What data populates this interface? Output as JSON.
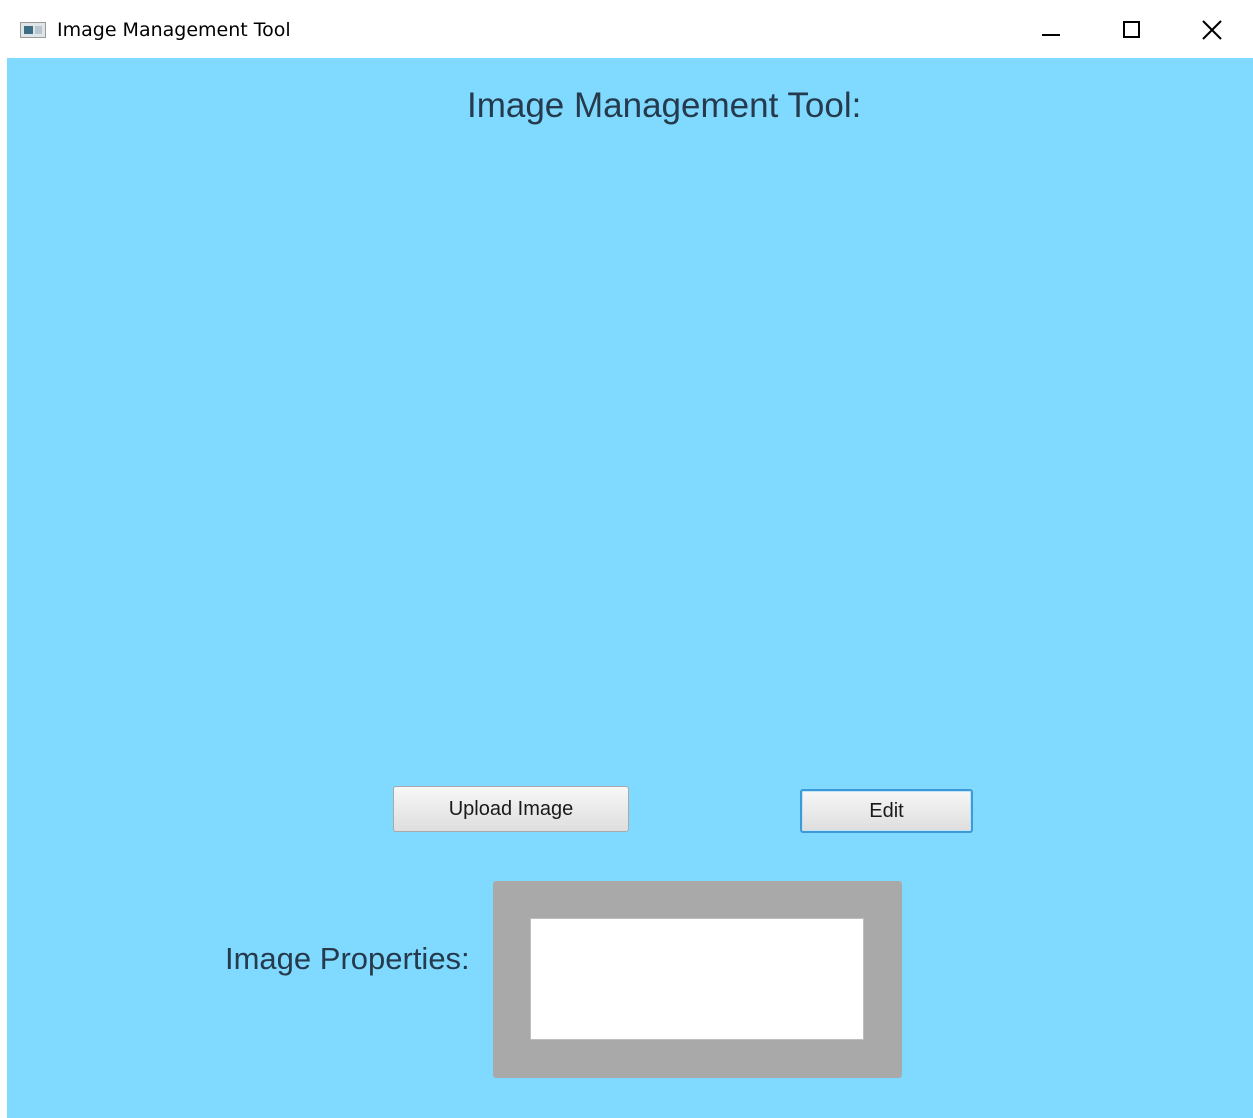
{
  "window": {
    "title": "Image Management Tool"
  },
  "main": {
    "heading": "Image Management Tool:",
    "upload_button_label": "Upload Image",
    "edit_button_label": "Edit",
    "properties_label": "Image Properties:",
    "properties_text": ""
  },
  "colors": {
    "background": "#80daff",
    "frame": "#a9a9a9",
    "focus_border": "#3d9ad6",
    "text": "#253a4c"
  },
  "icons": {
    "app": "app-window-icon",
    "minimize": "minimize-icon",
    "maximize": "maximize-icon",
    "close": "close-icon"
  }
}
